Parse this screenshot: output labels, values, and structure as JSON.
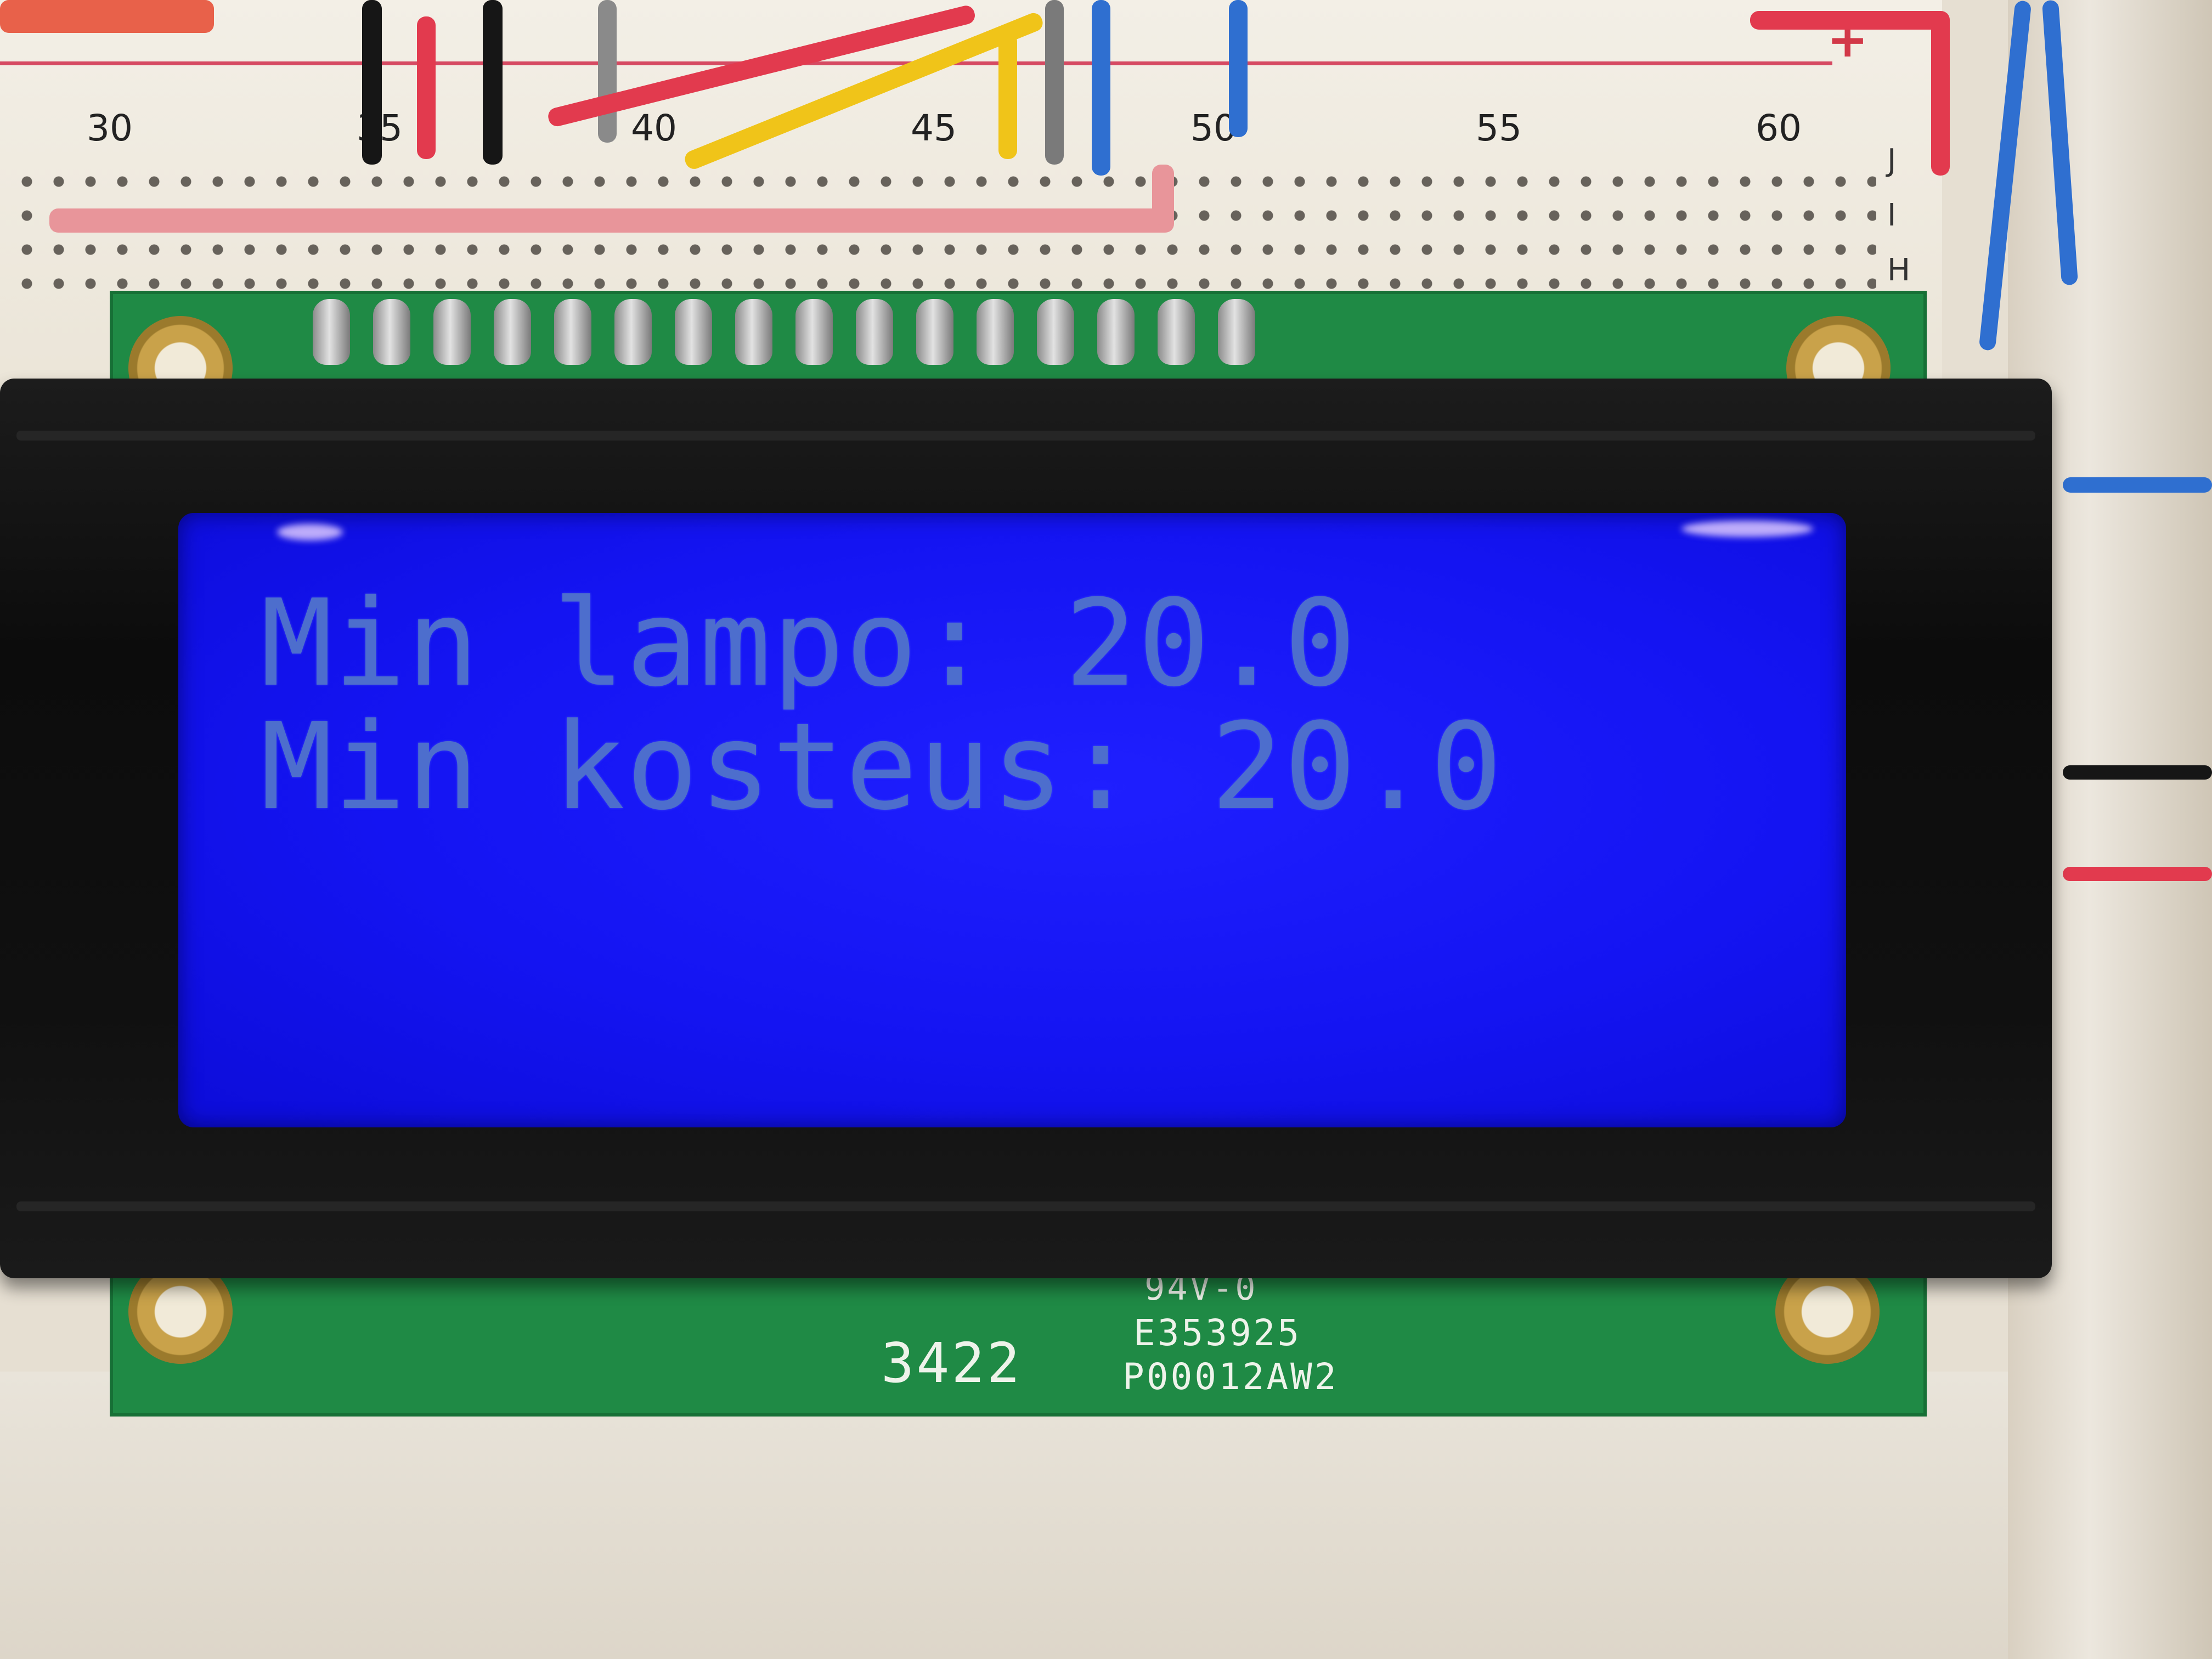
{
  "breadboard": {
    "column_numbers": [
      "30",
      "35",
      "40",
      "45",
      "50",
      "55",
      "60"
    ],
    "row_letters": [
      "J",
      "I",
      "H"
    ],
    "rail_symbol": "+"
  },
  "lcd": {
    "line1": "Min lampo: 20.0",
    "line2": "Min kosteus: 20.0",
    "backlight_color": "#1818f0",
    "text_color": "#4d6ecd"
  },
  "pcb": {
    "marking_1": "94V-0",
    "marking_2": "E353925",
    "marking_3": "P00012AW2",
    "date_code": "3422",
    "board_color": "#1f8a45"
  }
}
